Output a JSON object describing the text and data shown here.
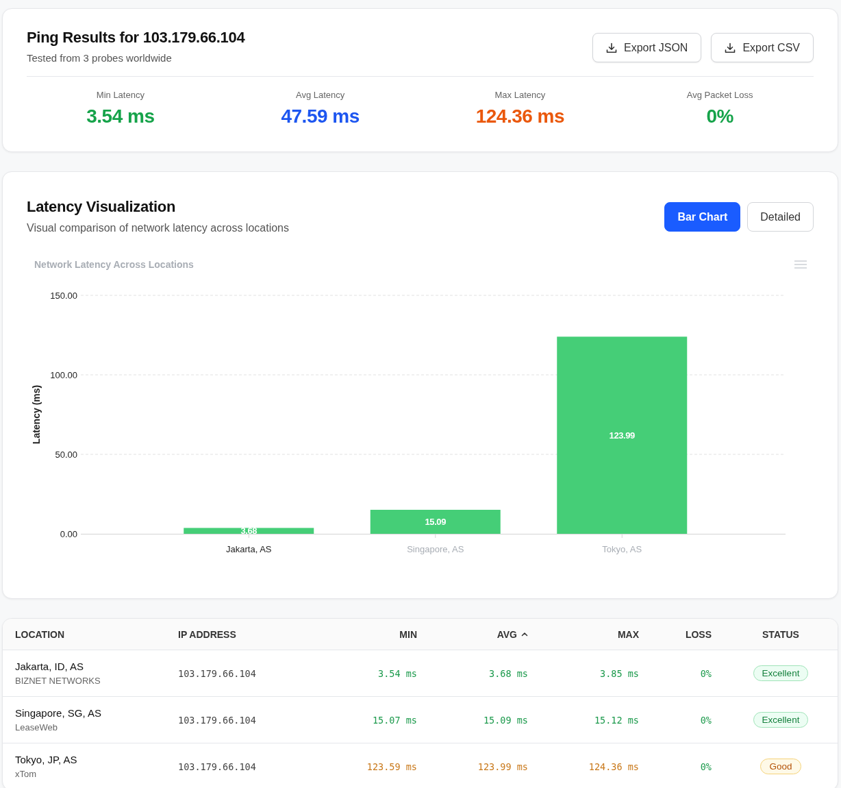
{
  "summary": {
    "title": "Ping Results for 103.179.66.104",
    "subtitle": "Tested from 3 probes worldwide",
    "actions": [
      {
        "label": "Export JSON"
      },
      {
        "label": "Export CSV"
      }
    ],
    "stats": [
      {
        "label": "Min Latency",
        "value": "3.54 ms",
        "color": "#16a34a"
      },
      {
        "label": "Avg Latency",
        "value": "47.59 ms",
        "color": "#1d56f0"
      },
      {
        "label": "Max Latency",
        "value": "124.36 ms",
        "color": "#ea580c"
      },
      {
        "label": "Avg Packet Loss",
        "value": "0%",
        "color": "#16a34a"
      }
    ]
  },
  "visualization": {
    "title": "Latency Visualization",
    "subtitle": "Visual comparison of network latency across locations",
    "view_toggle": [
      {
        "label": "Bar Chart",
        "selected": true
      },
      {
        "label": "Detailed",
        "selected": false
      }
    ],
    "chart_data": {
      "type": "bar",
      "title": "Network Latency Across Locations",
      "ylabel": "Latency (ms)",
      "categories": [
        "Jakarta, AS",
        "Singapore, AS",
        "Tokyo, AS"
      ],
      "series": [
        {
          "color": "#45ce77",
          "values": [
            3.68,
            15.09,
            123.99
          ]
        }
      ],
      "ylim": [
        0,
        150
      ],
      "yticks": [
        {
          "value": 0,
          "label": "0.00"
        },
        {
          "value": 50,
          "label": "50.00"
        },
        {
          "value": 100,
          "label": "100.00"
        },
        {
          "value": 150,
          "label": "150.00"
        }
      ],
      "value_labels": [
        "3.68",
        "15.09",
        "123.99"
      ]
    },
    "category_selected": [
      true,
      false,
      false
    ]
  },
  "table": {
    "columns": [
      {
        "label": "LOCATION",
        "sorted": false
      },
      {
        "label": "IP ADDRESS",
        "sorted": false
      },
      {
        "label": "MIN",
        "sorted": false
      },
      {
        "label": "AVG",
        "sorted": true
      },
      {
        "label": "MAX",
        "sorted": false
      },
      {
        "label": "LOSS",
        "sorted": false
      },
      {
        "label": "STATUS",
        "sorted": false
      }
    ],
    "rows": [
      {
        "location": "Jakarta, ID, AS",
        "provider": "BIZNET NETWORKS",
        "ip": "103.179.66.104",
        "min": "3.54 ms",
        "avg": "3.68 ms",
        "max": "3.85 ms",
        "loss": "0%",
        "status": {
          "label": "Excellent",
          "kind": "excellent"
        }
      },
      {
        "location": "Singapore, SG, AS",
        "provider": "LeaseWeb",
        "ip": "103.179.66.104",
        "min": "15.07 ms",
        "avg": "15.09 ms",
        "max": "15.12 ms",
        "loss": "0%",
        "status": {
          "label": "Excellent",
          "kind": "excellent"
        }
      },
      {
        "location": "Tokyo, JP, AS",
        "provider": "xTom",
        "ip": "103.179.66.104",
        "min": "123.59 ms",
        "avg": "123.99 ms",
        "max": "124.36 ms",
        "loss": "0%",
        "status": {
          "label": "Good",
          "kind": "good"
        }
      }
    ]
  }
}
